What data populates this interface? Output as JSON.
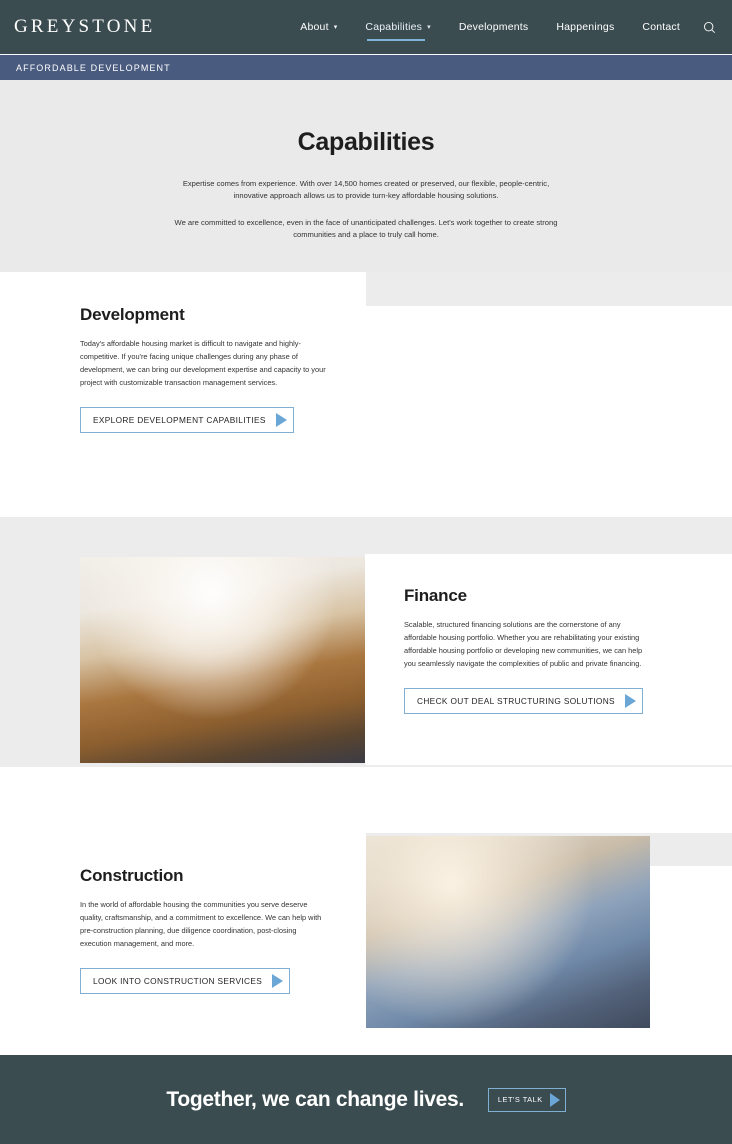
{
  "brand": {
    "logo_text": "GREYSTONE"
  },
  "header": {
    "nav": [
      {
        "label": "About",
        "has_caret": true,
        "active": false
      },
      {
        "label": "Capabilities",
        "has_caret": true,
        "active": true
      },
      {
        "label": "Developments",
        "has_caret": false,
        "active": false
      },
      {
        "label": "Happenings",
        "has_caret": false,
        "active": false
      },
      {
        "label": "Contact",
        "has_caret": false,
        "active": false
      }
    ],
    "search_icon": "search-icon",
    "caret_glyph": "▾",
    "background_color": "#3b4c50"
  },
  "subheader": {
    "label": "AFFORDABLE DEVELOPMENT",
    "background_color": "#4a5b80"
  },
  "hero": {
    "title": "Capabilities",
    "paragraph_1": "Expertise comes from experience. With over 14,500 homes created or preserved, our flexible, people-centric, innovative approach allows us to provide turn-key affordable housing solutions.",
    "paragraph_2": "We are committed to excellence, even in the face of unanticipated challenges. Let's work together to create strong communities and a place to truly call home.",
    "background_color": "#eaeaea"
  },
  "sections": [
    {
      "id": "development",
      "title": "Development",
      "body": "Today's affordable housing market is difficult to navigate and highly-competitive. If you're facing unique challenges during any phase of development, we can bring our development expertise and capacity to your project with customizable transaction management services.",
      "button_label": "EXPLORE DEVELOPMENT CAPABILITIES",
      "image_alt": "development-team-reviewing-model-photo"
    },
    {
      "id": "finance",
      "title": "Finance",
      "body": "Scalable, structured financing solutions are the cornerstone of any affordable housing portfolio. Whether you are rehabilitating your existing affordable housing portfolio or developing new communities, we can help you seamlessly navigate the complexities of public and private financing.",
      "button_label": "CHECK OUT DEAL STRUCTURING SOLUTIONS",
      "image_alt": "handshake-over-desk-photo"
    },
    {
      "id": "construction",
      "title": "Construction",
      "body": "In the world of affordable housing the communities you serve deserve quality, craftsmanship, and a commitment to excellence. We can help with pre-construction planning, due diligence coordination, post-closing execution management, and more.",
      "button_label": "LOOK INTO CONSTRUCTION SERVICES",
      "image_alt": "construction-workers-blueprint-photo"
    }
  ],
  "cta": {
    "title": "Together, we can change lives.",
    "button_label": "LET'S TALK",
    "background_color": "#3b4c50"
  },
  "theme": {
    "accent_blue": "#7fb0d4",
    "arrow_blue": "#6aa7d6",
    "dark_slate": "#3b4c50",
    "subbar_blue": "#4a5b80",
    "light_gray": "#ececec"
  }
}
